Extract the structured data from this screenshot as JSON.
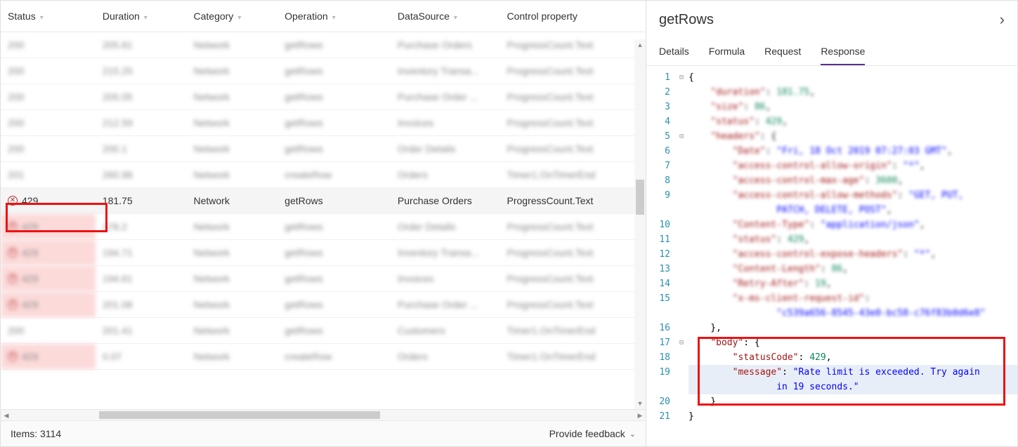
{
  "columns": [
    "Status",
    "Duration",
    "Category",
    "Operation",
    "DataSource",
    "Control property"
  ],
  "rows": [
    {
      "status": "200",
      "dur": "205.61",
      "cat": "Network",
      "op": "getRows",
      "ds": "Purchase Orders",
      "prop": "ProgressCount.Text",
      "err": false,
      "blur": true
    },
    {
      "status": "200",
      "dur": "215.25",
      "cat": "Network",
      "op": "getRows",
      "ds": "Inventory Transa...",
      "prop": "ProgressCount.Text",
      "err": false,
      "blur": true
    },
    {
      "status": "200",
      "dur": "205.05",
      "cat": "Network",
      "op": "getRows",
      "ds": "Purchase Order ...",
      "prop": "ProgressCount.Text",
      "err": false,
      "blur": true
    },
    {
      "status": "200",
      "dur": "212.59",
      "cat": "Network",
      "op": "getRows",
      "ds": "Invoices",
      "prop": "ProgressCount.Text",
      "err": false,
      "blur": true
    },
    {
      "status": "200",
      "dur": "200.1",
      "cat": "Network",
      "op": "getRows",
      "ds": "Order Details",
      "prop": "ProgressCount.Text",
      "err": false,
      "blur": true
    },
    {
      "status": "201",
      "dur": "260.98",
      "cat": "Network",
      "op": "createRow",
      "ds": "Orders",
      "prop": "Timer1.OnTimerEnd",
      "err": false,
      "blur": true
    },
    {
      "status": "429",
      "dur": "181.75",
      "cat": "Network",
      "op": "getRows",
      "ds": "Purchase Orders",
      "prop": "ProgressCount.Text",
      "err": true,
      "blur": false,
      "selected": true
    },
    {
      "status": "429",
      "dur": "178.2",
      "cat": "Network",
      "op": "getRows",
      "ds": "Order Details",
      "prop": "ProgressCount.Text",
      "err": true,
      "blur": true
    },
    {
      "status": "429",
      "dur": "194.71",
      "cat": "Network",
      "op": "getRows",
      "ds": "Inventory Transa...",
      "prop": "ProgressCount.Text",
      "err": true,
      "blur": true
    },
    {
      "status": "429",
      "dur": "194.61",
      "cat": "Network",
      "op": "getRows",
      "ds": "Invoices",
      "prop": "ProgressCount.Text",
      "err": true,
      "blur": true
    },
    {
      "status": "429",
      "dur": "201.08",
      "cat": "Network",
      "op": "getRows",
      "ds": "Purchase Order ...",
      "prop": "ProgressCount.Text",
      "err": true,
      "blur": true
    },
    {
      "status": "200",
      "dur": "201.41",
      "cat": "Network",
      "op": "getRows",
      "ds": "Customers",
      "prop": "Timer1.OnTimerEnd",
      "err": false,
      "blur": true
    },
    {
      "status": "429",
      "dur": "0.07",
      "cat": "Network",
      "op": "createRow",
      "ds": "Orders",
      "prop": "Timer1.OnTimerEnd",
      "err": true,
      "blur": true
    }
  ],
  "footer": {
    "items": "Items: 3114",
    "feedback": "Provide feedback"
  },
  "detail": {
    "title": "getRows",
    "tabs": [
      "Details",
      "Formula",
      "Request",
      "Response"
    ],
    "active": 3,
    "code": [
      {
        "n": 1,
        "fold": "⊟",
        "txt": [
          {
            "t": "{",
            "c": "punc"
          }
        ]
      },
      {
        "n": 2,
        "blur": true,
        "txt": [
          {
            "t": "    ",
            "c": ""
          },
          {
            "t": "\"duration\"",
            "c": "key"
          },
          {
            "t": ": ",
            "c": "punc"
          },
          {
            "t": "181.75",
            "c": "num"
          },
          {
            "t": ",",
            "c": "punc"
          }
        ]
      },
      {
        "n": 3,
        "blur": true,
        "txt": [
          {
            "t": "    ",
            "c": ""
          },
          {
            "t": "\"size\"",
            "c": "key"
          },
          {
            "t": ": ",
            "c": "punc"
          },
          {
            "t": "86",
            "c": "num"
          },
          {
            "t": ",",
            "c": "punc"
          }
        ]
      },
      {
        "n": 4,
        "blur": true,
        "txt": [
          {
            "t": "    ",
            "c": ""
          },
          {
            "t": "\"status\"",
            "c": "key"
          },
          {
            "t": ": ",
            "c": "punc"
          },
          {
            "t": "429",
            "c": "num"
          },
          {
            "t": ",",
            "c": "punc"
          }
        ]
      },
      {
        "n": 5,
        "fold": "⊟",
        "blur": true,
        "txt": [
          {
            "t": "    ",
            "c": ""
          },
          {
            "t": "\"headers\"",
            "c": "key"
          },
          {
            "t": ": {",
            "c": "punc"
          }
        ]
      },
      {
        "n": 6,
        "blur": true,
        "txt": [
          {
            "t": "        ",
            "c": ""
          },
          {
            "t": "\"Date\"",
            "c": "key"
          },
          {
            "t": ": ",
            "c": "punc"
          },
          {
            "t": "\"Fri, 18 Oct 2019 07:27:03 GMT\"",
            "c": "str"
          },
          {
            "t": ",",
            "c": "punc"
          }
        ]
      },
      {
        "n": 7,
        "blur": true,
        "txt": [
          {
            "t": "        ",
            "c": ""
          },
          {
            "t": "\"access-control-allow-origin\"",
            "c": "key"
          },
          {
            "t": ": ",
            "c": "punc"
          },
          {
            "t": "\"*\"",
            "c": "str"
          },
          {
            "t": ",",
            "c": "punc"
          }
        ]
      },
      {
        "n": 8,
        "blur": true,
        "txt": [
          {
            "t": "        ",
            "c": ""
          },
          {
            "t": "\"access-control-max-age\"",
            "c": "key"
          },
          {
            "t": ": ",
            "c": "punc"
          },
          {
            "t": "3600",
            "c": "num"
          },
          {
            "t": ",",
            "c": "punc"
          }
        ]
      },
      {
        "n": 9,
        "blur": true,
        "txt": [
          {
            "t": "        ",
            "c": ""
          },
          {
            "t": "\"access-control-allow-methods\"",
            "c": "key"
          },
          {
            "t": ": ",
            "c": "punc"
          },
          {
            "t": "\"GET, PUT,",
            "c": "str"
          }
        ]
      },
      {
        "n": "",
        "blur": true,
        "txt": [
          {
            "t": "                PATCH, DELETE, POST\"",
            "c": "str"
          },
          {
            "t": ",",
            "c": "punc"
          }
        ]
      },
      {
        "n": 10,
        "blur": true,
        "txt": [
          {
            "t": "        ",
            "c": ""
          },
          {
            "t": "\"Content-Type\"",
            "c": "key"
          },
          {
            "t": ": ",
            "c": "punc"
          },
          {
            "t": "\"application/json\"",
            "c": "str"
          },
          {
            "t": ",",
            "c": "punc"
          }
        ]
      },
      {
        "n": 11,
        "blur": true,
        "txt": [
          {
            "t": "        ",
            "c": ""
          },
          {
            "t": "\"status\"",
            "c": "key"
          },
          {
            "t": ": ",
            "c": "punc"
          },
          {
            "t": "429",
            "c": "num"
          },
          {
            "t": ",",
            "c": "punc"
          }
        ]
      },
      {
        "n": 12,
        "blur": true,
        "txt": [
          {
            "t": "        ",
            "c": ""
          },
          {
            "t": "\"access-control-expose-headers\"",
            "c": "key"
          },
          {
            "t": ": ",
            "c": "punc"
          },
          {
            "t": "\"*\"",
            "c": "str"
          },
          {
            "t": ",",
            "c": "punc"
          }
        ]
      },
      {
        "n": 13,
        "blur": true,
        "txt": [
          {
            "t": "        ",
            "c": ""
          },
          {
            "t": "\"Content-Length\"",
            "c": "key"
          },
          {
            "t": ": ",
            "c": "punc"
          },
          {
            "t": "86",
            "c": "num"
          },
          {
            "t": ",",
            "c": "punc"
          }
        ]
      },
      {
        "n": 14,
        "blur": true,
        "txt": [
          {
            "t": "        ",
            "c": ""
          },
          {
            "t": "\"Retry-After\"",
            "c": "key"
          },
          {
            "t": ": ",
            "c": "punc"
          },
          {
            "t": "19",
            "c": "num"
          },
          {
            "t": ",",
            "c": "punc"
          }
        ]
      },
      {
        "n": 15,
        "blur": true,
        "txt": [
          {
            "t": "        ",
            "c": ""
          },
          {
            "t": "\"x-ms-client-request-id\"",
            "c": "key"
          },
          {
            "t": ":",
            "c": "punc"
          }
        ]
      },
      {
        "n": "",
        "blur": true,
        "txt": [
          {
            "t": "                ",
            "c": ""
          },
          {
            "t": "\"c539a656-8545-43e0-bc58-c76f83b0d6e8\"",
            "c": "str"
          }
        ]
      },
      {
        "n": 16,
        "txt": [
          {
            "t": "    },",
            "c": "punc"
          }
        ]
      },
      {
        "n": 17,
        "fold": "⊟",
        "txt": [
          {
            "t": "    ",
            "c": ""
          },
          {
            "t": "\"body\"",
            "c": "key"
          },
          {
            "t": ": {",
            "c": "punc"
          }
        ]
      },
      {
        "n": 18,
        "txt": [
          {
            "t": "        ",
            "c": ""
          },
          {
            "t": "\"statusCode\"",
            "c": "key"
          },
          {
            "t": ": ",
            "c": "punc"
          },
          {
            "t": "429",
            "c": "num"
          },
          {
            "t": ",",
            "c": "punc"
          }
        ]
      },
      {
        "n": 19,
        "hl": true,
        "txt": [
          {
            "t": "        ",
            "c": ""
          },
          {
            "t": "\"message\"",
            "c": "key"
          },
          {
            "t": ": ",
            "c": "punc"
          },
          {
            "t": "\"Rate limit is exceeded. Try again ",
            "c": "str"
          }
        ]
      },
      {
        "n": "",
        "hl": true,
        "txt": [
          {
            "t": "                in 19 seconds.\"",
            "c": "str"
          }
        ]
      },
      {
        "n": 20,
        "txt": [
          {
            "t": "    }",
            "c": "punc"
          }
        ]
      },
      {
        "n": 21,
        "txt": [
          {
            "t": "}",
            "c": "punc"
          }
        ]
      }
    ]
  }
}
